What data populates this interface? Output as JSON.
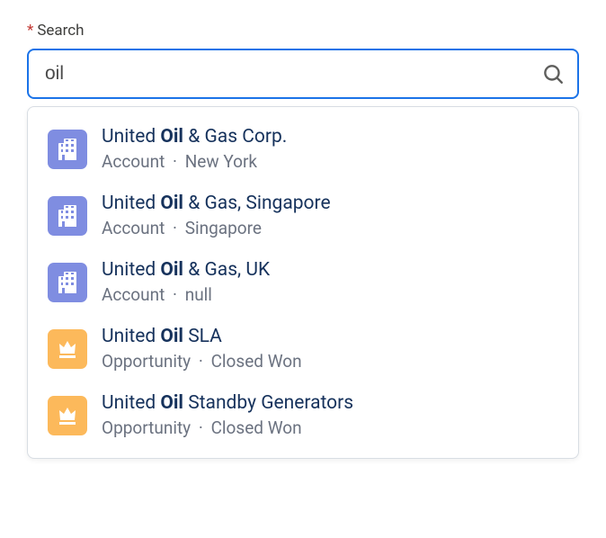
{
  "field": {
    "label": "Search",
    "required_marker": "*"
  },
  "search": {
    "value": "oil",
    "placeholder": ""
  },
  "results": [
    {
      "type": "account",
      "icon_name": "building-icon",
      "title_pre": "United ",
      "title_match": "Oil",
      "title_post": " & Gas Corp.",
      "meta_type": "Account",
      "meta_detail": "New York"
    },
    {
      "type": "account",
      "icon_name": "building-icon",
      "title_pre": "United ",
      "title_match": "Oil",
      "title_post": " & Gas, Singapore",
      "meta_type": "Account",
      "meta_detail": "Singapore"
    },
    {
      "type": "account",
      "icon_name": "building-icon",
      "title_pre": "United ",
      "title_match": "Oil",
      "title_post": " & Gas, UK",
      "meta_type": "Account",
      "meta_detail": "null"
    },
    {
      "type": "opportunity",
      "icon_name": "crown-icon",
      "title_pre": "United ",
      "title_match": "Oil",
      "title_post": " SLA",
      "meta_type": "Opportunity",
      "meta_detail": "Closed Won"
    },
    {
      "type": "opportunity",
      "icon_name": "crown-icon",
      "title_pre": "United ",
      "title_match": "Oil",
      "title_post": " Standby Generators",
      "meta_type": "Opportunity",
      "meta_detail": "Closed Won"
    }
  ],
  "meta_separator": "·"
}
